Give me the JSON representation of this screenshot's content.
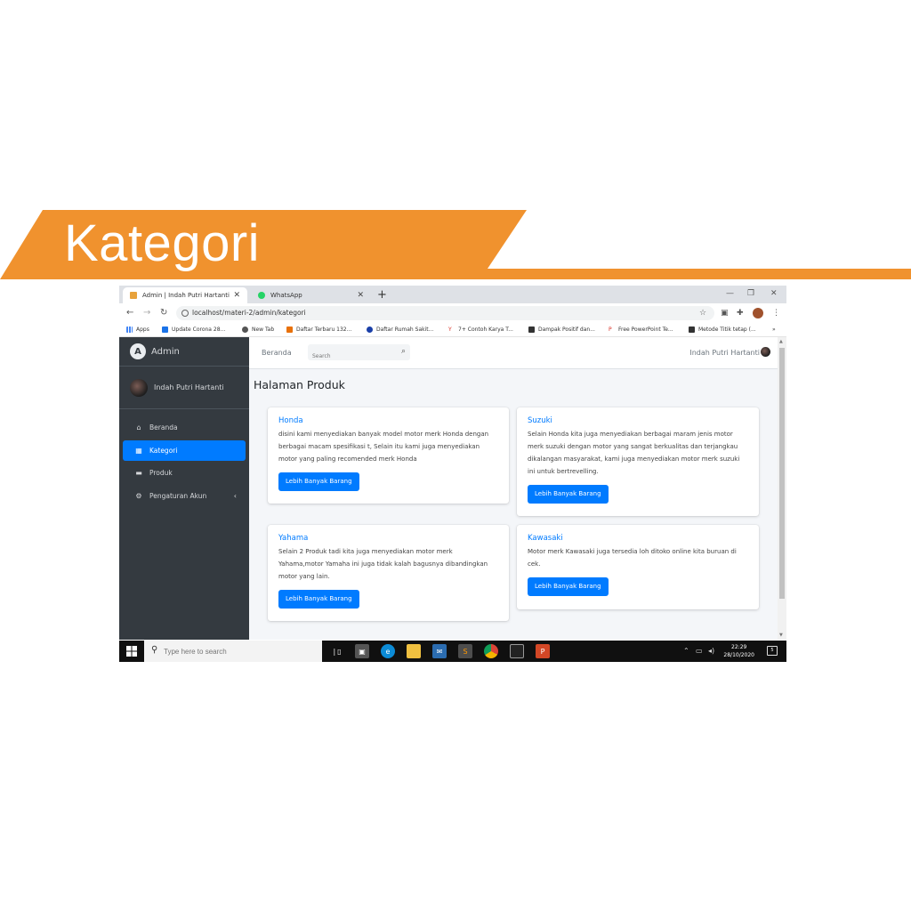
{
  "slide": {
    "title": "Kategori",
    "accent_color": "#f0922e"
  },
  "browser": {
    "tabs": [
      {
        "label": "Admin | Indah Putri Hartanti",
        "icon": "admin-favicon"
      },
      {
        "label": "WhatsApp",
        "icon": "whatsapp-favicon"
      }
    ],
    "url": "localhost/materi-2/admin/kategori",
    "bookmarks": [
      "Apps",
      "Update Corona 28...",
      "New Tab",
      "Daftar Terbaru 132...",
      "Daftar Rumah Sakit...",
      "7+ Contoh Karya T...",
      "Dampak Positif dan...",
      "Free PowerPoint Te...",
      "Metode Titik tetap (...",
      "»"
    ]
  },
  "app": {
    "brand": "Admin",
    "user_name": "Indah Putri Hartanti",
    "menu": [
      {
        "label": "Beranda",
        "icon": "home-icon"
      },
      {
        "label": "Kategori",
        "icon": "grid-icon"
      },
      {
        "label": "Produk",
        "icon": "box-icon"
      },
      {
        "label": "Pengaturan Akun",
        "icon": "users-cog-icon"
      }
    ],
    "topnav": {
      "home_link": "Beranda",
      "search_placeholder": "Search",
      "user_name": "Indah Putri Hartanti"
    },
    "page_title": "Halaman Produk",
    "cards": [
      {
        "title": "Honda",
        "text": "disini kami menyediakan banyak model motor merk Honda dengan berbagai macam spesifikasi t, Selain itu kami juga menyediakan motor yang paling recomended merk Honda",
        "button": "Lebih Banyak Barang"
      },
      {
        "title": "Suzuki",
        "text": "Selain Honda kita juga menyediakan berbagai maram jenis motor merk suzuki dengan motor yang sangat berkualitas dan terjangkau dikalangan masyarakat, kami juga menyediakan motor merk suzuki ini untuk bertrevelling.",
        "button": "Lebih Banyak Barang"
      },
      {
        "title": "Yahama",
        "text": "Selain 2 Produk tadi kita juga menyediakan motor merk Yahama,motor Yamaha ini juga tidak kalah bagusnya dibandingkan motor yang lain.",
        "button": "Lebih Banyak Barang"
      },
      {
        "title": "Kawasaki",
        "text": "Motor merk Kawasaki juga tersedia loh ditoko online kita buruan di cek.",
        "button": "Lebih Banyak Barang"
      }
    ]
  },
  "taskbar": {
    "search_placeholder": "Type here to search",
    "time": "22:29",
    "date": "28/10/2020",
    "notifications": "5"
  }
}
